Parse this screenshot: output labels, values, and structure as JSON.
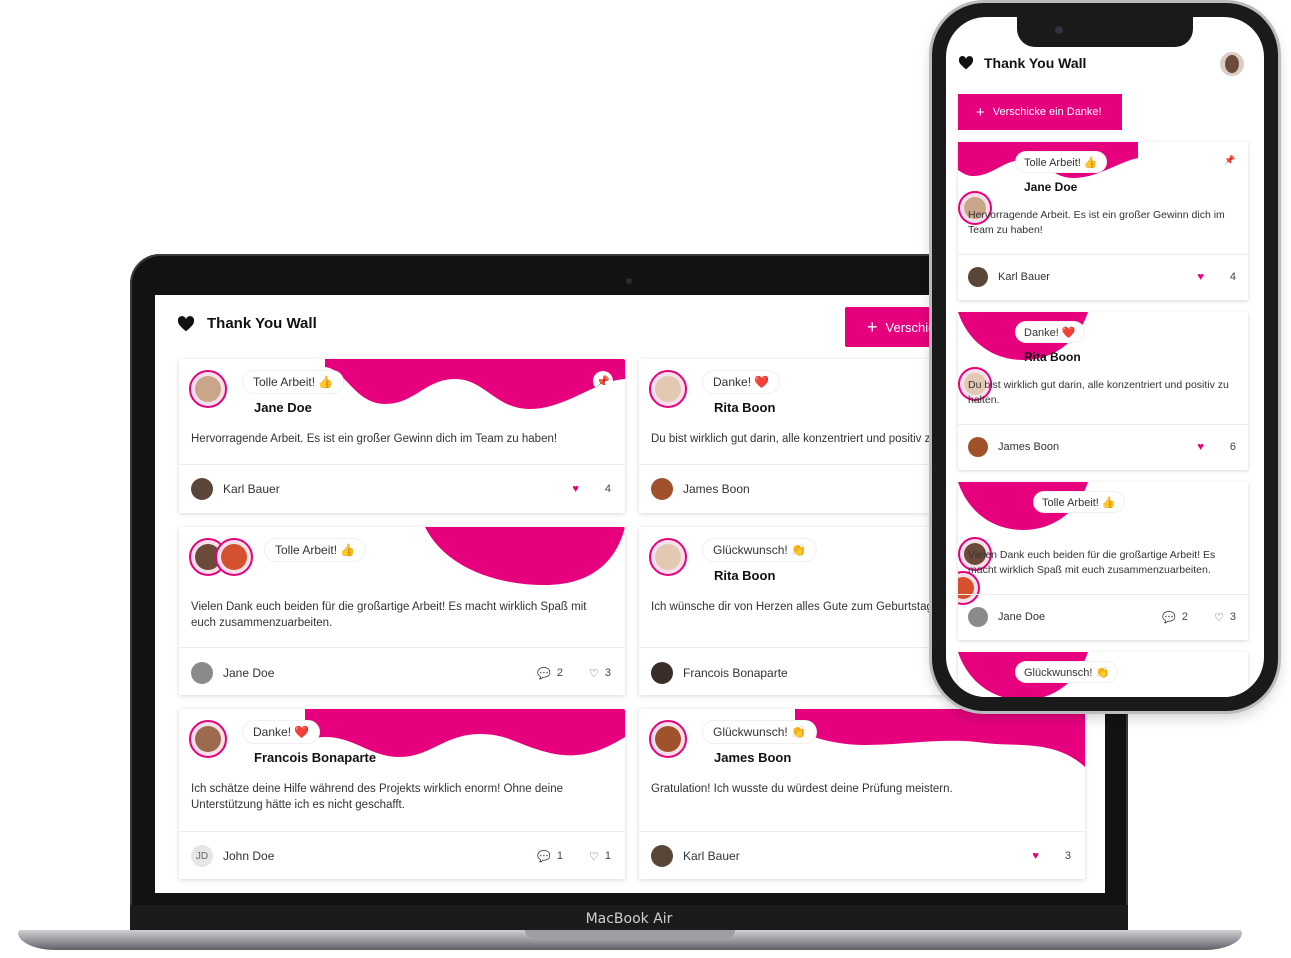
{
  "colors": {
    "accent": "#e6007e",
    "heart": "#e6007e",
    "text": "#222222"
  },
  "app": {
    "title": "Thank You Wall",
    "send_button": "Verschicke ein Danke!",
    "mobile_send_button": "Verschicke ein Danke!"
  },
  "device": {
    "laptop_label": "MacBook Air"
  },
  "cards": [
    {
      "badge": "Tolle Arbeit! 👍",
      "recipient": "Jane Doe",
      "message": "Hervorragende Arbeit. Es ist ein großer Gewinn dich im Team zu haben!",
      "sender": "Karl Bauer",
      "likes": "4",
      "comments": "",
      "pinned": true
    },
    {
      "badge": "Danke! ❤️",
      "recipient": "Rita Boon",
      "message": "Du bist wirklich gut darin, alle konzentriert und positiv zu halten.",
      "sender": "James Boon",
      "likes": "6",
      "comments": ""
    },
    {
      "badge": "Tolle Arbeit! 👍",
      "recipient": "",
      "message": "Vielen Dank euch beiden für die großartige Arbeit! Es macht wirklich Spaß mit euch zusammenzuarbeiten.",
      "sender": "Jane Doe",
      "likes": "3",
      "comments": "2"
    },
    {
      "badge": "Glückwunsch! 👏",
      "recipient": "Rita Boon",
      "message": "Ich wünsche dir von Herzen alles Gute zum Geburtstag!",
      "sender": "Francois Bonaparte",
      "likes": "",
      "comments": ""
    },
    {
      "badge": "Danke! ❤️",
      "recipient": "Francois Bonaparte",
      "message": "Ich schätze deine Hilfe während des Projekts wirklich enorm! Ohne deine Unterstützung hätte ich es nicht geschafft.",
      "sender": "John Doe",
      "sender_initials": "JD",
      "likes": "1",
      "comments": "1"
    },
    {
      "badge": "Glückwunsch! 👏",
      "recipient": "James Boon",
      "message": "Gratulation! Ich wusste du würdest deine Prüfung meistern.",
      "sender": "Karl Bauer",
      "likes": "3",
      "comments": ""
    }
  ],
  "mobile_cards": [
    {
      "badge": "Tolle Arbeit! 👍",
      "recipient": "Jane Doe",
      "message": "Hervorragende Arbeit. Es ist ein großer Gewinn dich im Team zu haben!",
      "sender": "Karl Bauer",
      "likes": "4"
    },
    {
      "badge": "Danke! ❤️",
      "recipient": "Rita Boon",
      "message": "Du bist wirklich gut darin, alle konzentriert und positiv zu halten.",
      "sender": "James Boon",
      "likes": "6"
    },
    {
      "badge": "Tolle Arbeit! 👍",
      "message": "Vielen Dank euch beiden für die großartige Arbeit! Es macht wirklich Spaß mit euch zusammenzuarbeiten.",
      "sender": "Jane Doe",
      "comments": "2",
      "likes": "3"
    },
    {
      "badge": "Glückwunsch! 👏"
    }
  ]
}
